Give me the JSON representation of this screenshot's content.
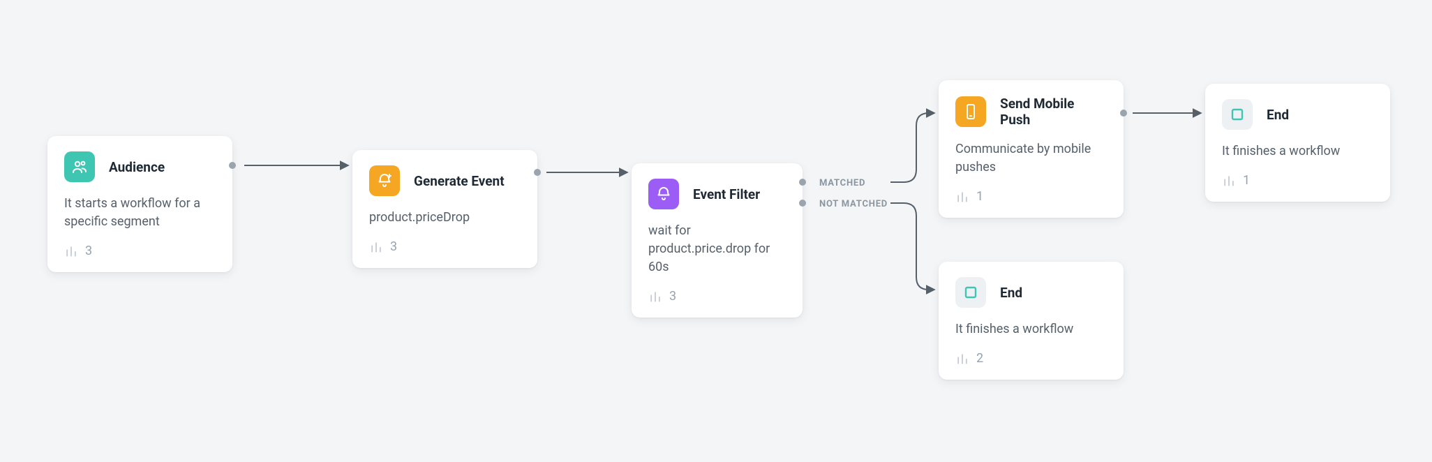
{
  "nodes": {
    "audience": {
      "title": "Audience",
      "desc": "It starts a workflow for a specific segment",
      "count": "3"
    },
    "generate": {
      "title": "Generate Event",
      "desc": "product.priceDrop",
      "count": "3"
    },
    "filter": {
      "title": "Event Filter",
      "desc": "wait for product.price.drop for 60s",
      "count": "3",
      "port_matched": "MATCHED",
      "port_not_matched": "NOT MATCHED"
    },
    "push": {
      "title": "Send Mobile Push",
      "desc": "Communicate by mobile pushes",
      "count": "1"
    },
    "end_top": {
      "title": "End",
      "desc": "It finishes a workflow",
      "count": "1"
    },
    "end_bottom": {
      "title": "End",
      "desc": "It finishes a workflow",
      "count": "2"
    }
  },
  "colors": {
    "teal": "#3fc6b3",
    "orange": "#f5a623",
    "purple": "#9c5cf6",
    "endStroke": "#3fc6b3",
    "arrow": "#55606b"
  }
}
